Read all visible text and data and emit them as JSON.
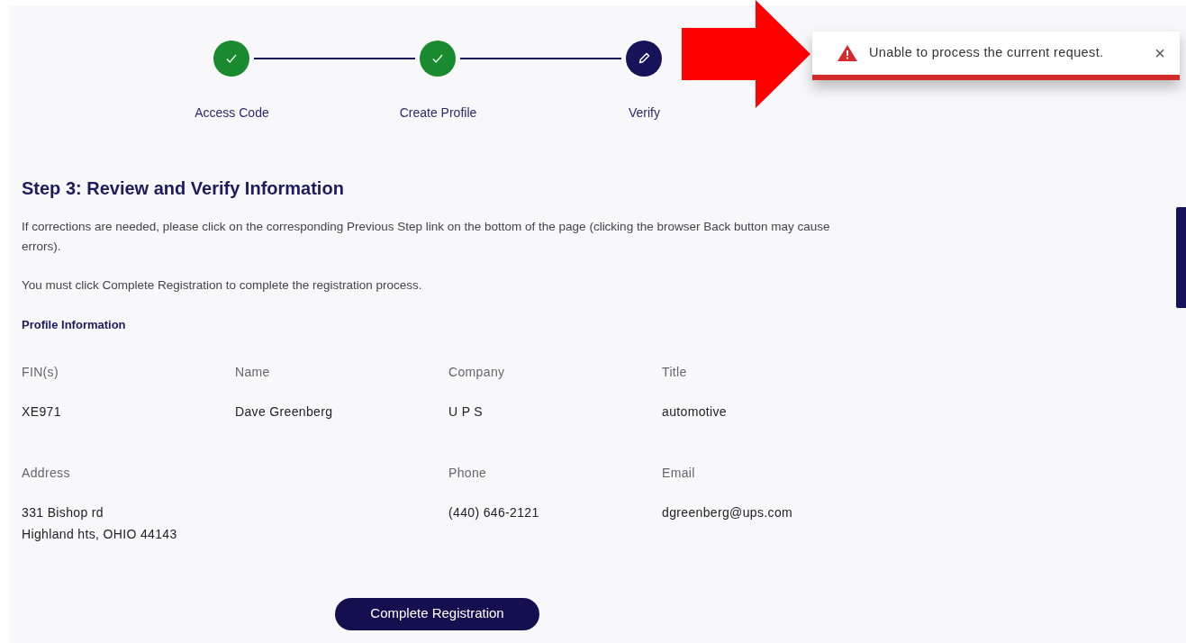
{
  "stepper": [
    {
      "label": "Access Code",
      "completed": true
    },
    {
      "label": "Create Profile",
      "completed": true
    },
    {
      "label": "Verify",
      "completed": false
    }
  ],
  "toast": {
    "message": "Unable to process the current request.",
    "close": "×"
  },
  "heading": "Step 3: Review and Verify Information",
  "paragraphs": [
    "If corrections are needed, please click on the corresponding Previous Step link on the bottom of the page (clicking the browser Back button may cause errors).",
    "You must click Complete Registration to complete the registration process."
  ],
  "section_title": "Profile Information",
  "field_rows": [
    [
      {
        "label": "FIN(s)",
        "lines": [
          "XE971"
        ]
      },
      {
        "label": "Name",
        "lines": [
          "Dave Greenberg"
        ]
      },
      {
        "label": "Company",
        "lines": [
          "U P S"
        ]
      },
      {
        "label": "Title",
        "lines": [
          "automotive"
        ]
      }
    ],
    [
      {
        "label": "Address",
        "lines": [
          "331 Bishop rd",
          "Highland hts, OHIO 44143"
        ],
        "kind": "wide"
      },
      {
        "label": "Phone",
        "lines": [
          "(440) 646-2121"
        ]
      },
      {
        "label": "Email",
        "lines": [
          "dgreenberg@ups.com"
        ]
      }
    ]
  ],
  "primary_button": "Complete Registration"
}
